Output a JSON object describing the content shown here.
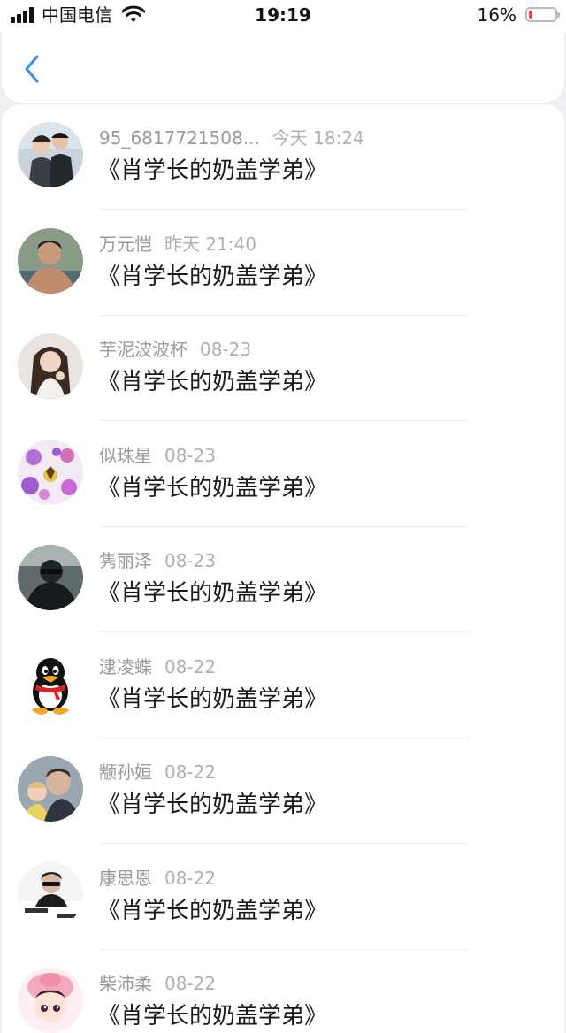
{
  "status_bar": {
    "carrier": "中国电信",
    "time": "19:19",
    "battery_percent": "16%",
    "battery_level": 0.16,
    "battery_color": "#ff3b30"
  },
  "nav": {
    "back_icon": "chevron-left-icon",
    "accent_color": "#3d8fe8"
  },
  "messages": [
    {
      "sender": "95_6817721508...",
      "time": "今天 18:24",
      "title": "《肖学长的奶盖学弟》"
    },
    {
      "sender": "万元恺",
      "time": "昨天 21:40",
      "title": "《肖学长的奶盖学弟》"
    },
    {
      "sender": "芋泥波波杯",
      "time": "08-23",
      "title": "《肖学长的奶盖学弟》"
    },
    {
      "sender": "似珠星",
      "time": "08-23",
      "title": "《肖学长的奶盖学弟》"
    },
    {
      "sender": "隽丽泽",
      "time": "08-23",
      "title": "《肖学长的奶盖学弟》"
    },
    {
      "sender": "逮凌蝶",
      "time": "08-22",
      "title": "《肖学长的奶盖学弟》"
    },
    {
      "sender": "颛孙姮",
      "time": "08-22",
      "title": "《肖学长的奶盖学弟》"
    },
    {
      "sender": "康思恩",
      "time": "08-22",
      "title": "《肖学长的奶盖学弟》"
    },
    {
      "sender": "柴沛柔",
      "time": "08-22",
      "title": "《肖学长的奶盖学弟》"
    }
  ]
}
